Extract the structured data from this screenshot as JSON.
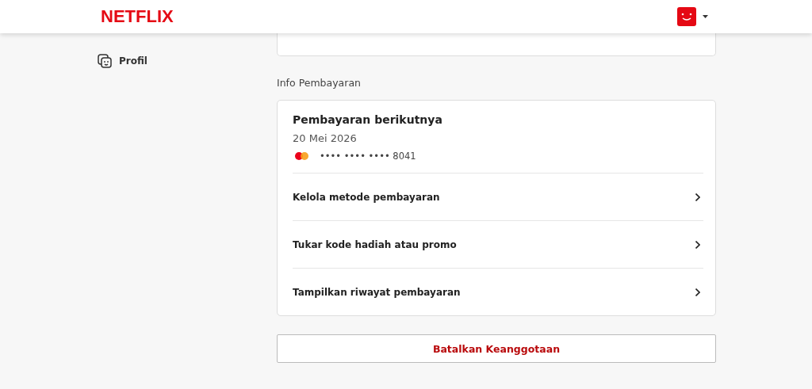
{
  "header": {
    "logo": "NETFLIX"
  },
  "sidebar": {
    "items": [
      {
        "kind": "profile",
        "label": "Profil"
      }
    ]
  },
  "payment": {
    "section_title": "Info Pembayaran",
    "next_title": "Pembayaran berikutnya",
    "next_date": "20 Mei 2026",
    "card_number": "•••• •••• •••• 8041",
    "actions": [
      {
        "label": "Kelola metode pembayaran"
      },
      {
        "label": "Tukar kode hadiah atau promo"
      },
      {
        "label": "Tampilkan riwayat pembayaran"
      }
    ]
  },
  "cancel_button": "Batalkan Keanggotaan"
}
